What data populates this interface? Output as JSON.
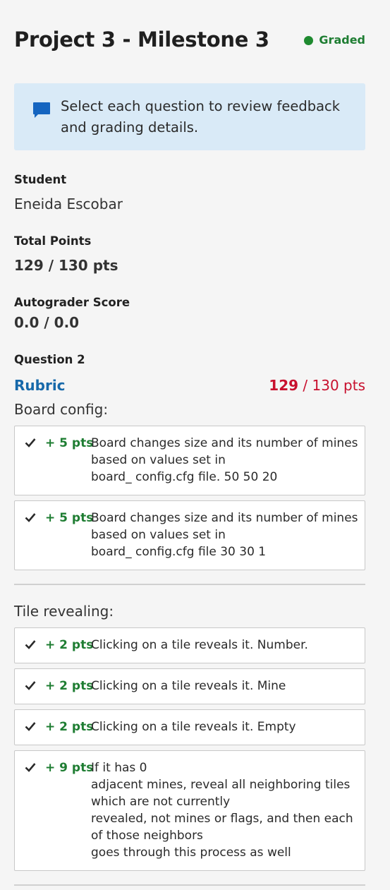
{
  "header": {
    "title": "Project 3 - Milestone 3",
    "status": "Graded",
    "status_color": "#1e8a2f"
  },
  "info": {
    "icon": "comment-icon",
    "message": "Select each question to review feedback and grading details."
  },
  "student": {
    "label": "Student",
    "value": "Eneida Escobar"
  },
  "total_points": {
    "label": "Total Points",
    "value": "129 / 130 pts"
  },
  "autograder": {
    "label": "Autograder Score",
    "value": "0.0 / 0.0"
  },
  "question": {
    "label": "Question 2",
    "rubric_link": "Rubric",
    "score_earned": "129",
    "score_total": " / 130 pts",
    "score_color": "#c8102e"
  },
  "sections": [
    {
      "title": "Board config:",
      "items": [
        {
          "points": "+ 5 pts",
          "text": "Board changes size and its number of mines\nbased on values set in\nboard_ config.cfg file.  50 50 20"
        },
        {
          "points": "+ 5 pts",
          "text": "Board changes size and its number of mines\nbased on values set in\nboard_ config.cfg file 30 30 1"
        }
      ]
    },
    {
      "title": "Tile revealing:",
      "items": [
        {
          "points": "+ 2 pts",
          "text": "Clicking on a tile reveals it. Number."
        },
        {
          "points": "+ 2 pts",
          "text": "Clicking on a tile reveals it. Mine"
        },
        {
          "points": "+ 2 pts",
          "text": "Clicking on a tile reveals it. Empty"
        },
        {
          "points": "+ 9 pts",
          "text": "If it has 0\nadjacent mines, reveal all neighboring tiles\nwhich are not currently\nrevealed, not mines or flags, and then each\nof those neighbors\ngoes through this process as well"
        }
      ]
    }
  ]
}
